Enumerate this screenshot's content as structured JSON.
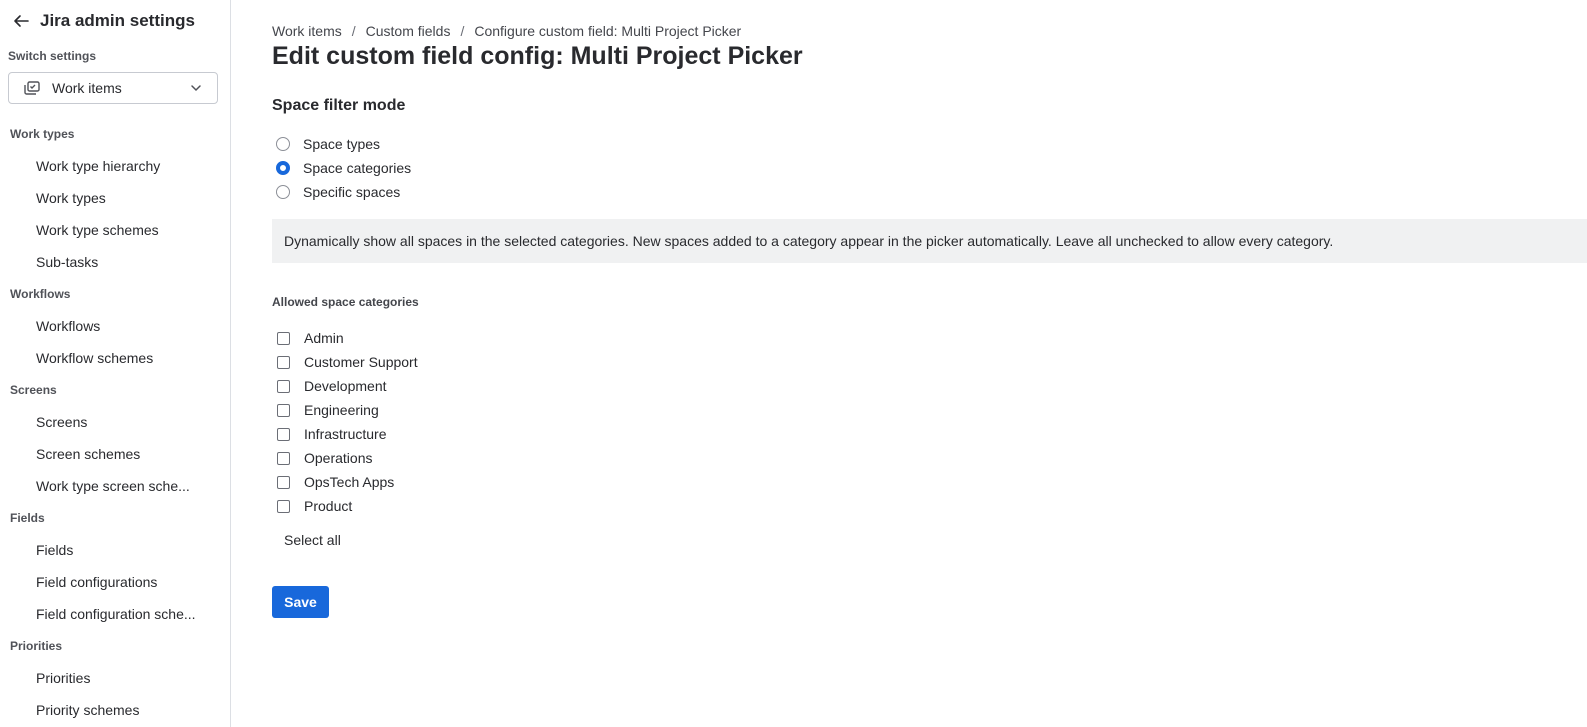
{
  "sidebar": {
    "title": "Jira admin settings",
    "switch_label": "Switch settings",
    "switcher_value": "Work items",
    "sections": [
      {
        "label": "Work types",
        "items": [
          "Work type hierarchy",
          "Work types",
          "Work type schemes",
          "Sub-tasks"
        ]
      },
      {
        "label": "Workflows",
        "items": [
          "Workflows",
          "Workflow schemes"
        ]
      },
      {
        "label": "Screens",
        "items": [
          "Screens",
          "Screen schemes",
          "Work type screen sche..."
        ]
      },
      {
        "label": "Fields",
        "items": [
          "Fields",
          "Field configurations",
          "Field configuration sche..."
        ]
      },
      {
        "label": "Priorities",
        "items": [
          "Priorities",
          "Priority schemes"
        ]
      }
    ]
  },
  "breadcrumb": [
    "Work items",
    "Custom fields",
    "Configure custom field: Multi Project Picker"
  ],
  "breadcrumb_separator": "/",
  "page_title": "Edit custom field config: Multi Project Picker",
  "filter_mode": {
    "heading": "Space filter mode",
    "options": [
      {
        "label": "Space types",
        "checked": false
      },
      {
        "label": "Space categories",
        "checked": true
      },
      {
        "label": "Specific spaces",
        "checked": false
      }
    ]
  },
  "info_text": "Dynamically show all spaces in the selected categories. New spaces added to a category appear in the picker automatically. Leave all unchecked to allow every category.",
  "allowed": {
    "label": "Allowed space categories",
    "categories": [
      "Admin",
      "Customer Support",
      "Development",
      "Engineering",
      "Infrastructure",
      "Operations",
      "OpsTech Apps",
      "Product"
    ],
    "select_all": "Select all"
  },
  "save_label": "Save",
  "colors": {
    "primary": "#1868db",
    "info_bg": "#f0f1f2",
    "text": "#292a2e"
  }
}
